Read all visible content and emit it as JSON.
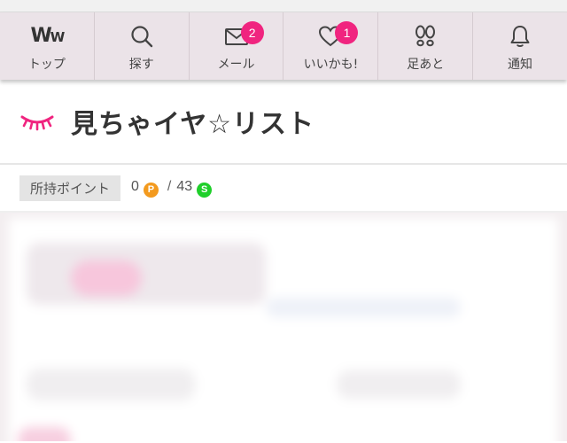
{
  "nav": {
    "items": [
      {
        "id": "top",
        "label": "トップ",
        "icon": "ww-logo-icon",
        "logo_big": "W",
        "logo_small": "W"
      },
      {
        "id": "search",
        "label": "探す",
        "icon": "search-icon"
      },
      {
        "id": "mail",
        "label": "メール",
        "icon": "mail-icon",
        "badge": "2"
      },
      {
        "id": "like",
        "label": "いいかも!",
        "icon": "heart-icon",
        "badge": "1"
      },
      {
        "id": "footprints",
        "label": "足あと",
        "icon": "footprints-icon"
      },
      {
        "id": "notify",
        "label": "通知",
        "icon": "bell-icon"
      }
    ]
  },
  "page": {
    "title": "見ちゃイヤ☆リスト",
    "title_icon": "closed-eye-icon"
  },
  "points": {
    "label": "所持ポイント",
    "p_value": "0",
    "p_coin": "P",
    "separator": "/",
    "s_value": "43",
    "s_coin": "S"
  },
  "colors": {
    "accent": "#f0247f",
    "nav_bg": "#ebe3e8",
    "coin_p": "#f39a1e",
    "coin_s": "#1fcf2a"
  }
}
